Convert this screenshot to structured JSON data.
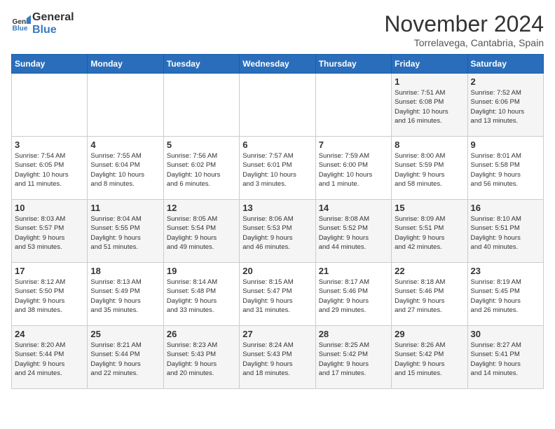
{
  "header": {
    "logo_general": "General",
    "logo_blue": "Blue",
    "month_title": "November 2024",
    "location": "Torrelavega, Cantabria, Spain"
  },
  "weekdays": [
    "Sunday",
    "Monday",
    "Tuesday",
    "Wednesday",
    "Thursday",
    "Friday",
    "Saturday"
  ],
  "weeks": [
    [
      {
        "day": "",
        "info": ""
      },
      {
        "day": "",
        "info": ""
      },
      {
        "day": "",
        "info": ""
      },
      {
        "day": "",
        "info": ""
      },
      {
        "day": "",
        "info": ""
      },
      {
        "day": "1",
        "info": "Sunrise: 7:51 AM\nSunset: 6:08 PM\nDaylight: 10 hours\nand 16 minutes."
      },
      {
        "day": "2",
        "info": "Sunrise: 7:52 AM\nSunset: 6:06 PM\nDaylight: 10 hours\nand 13 minutes."
      }
    ],
    [
      {
        "day": "3",
        "info": "Sunrise: 7:54 AM\nSunset: 6:05 PM\nDaylight: 10 hours\nand 11 minutes."
      },
      {
        "day": "4",
        "info": "Sunrise: 7:55 AM\nSunset: 6:04 PM\nDaylight: 10 hours\nand 8 minutes."
      },
      {
        "day": "5",
        "info": "Sunrise: 7:56 AM\nSunset: 6:02 PM\nDaylight: 10 hours\nand 6 minutes."
      },
      {
        "day": "6",
        "info": "Sunrise: 7:57 AM\nSunset: 6:01 PM\nDaylight: 10 hours\nand 3 minutes."
      },
      {
        "day": "7",
        "info": "Sunrise: 7:59 AM\nSunset: 6:00 PM\nDaylight: 10 hours\nand 1 minute."
      },
      {
        "day": "8",
        "info": "Sunrise: 8:00 AM\nSunset: 5:59 PM\nDaylight: 9 hours\nand 58 minutes."
      },
      {
        "day": "9",
        "info": "Sunrise: 8:01 AM\nSunset: 5:58 PM\nDaylight: 9 hours\nand 56 minutes."
      }
    ],
    [
      {
        "day": "10",
        "info": "Sunrise: 8:03 AM\nSunset: 5:57 PM\nDaylight: 9 hours\nand 53 minutes."
      },
      {
        "day": "11",
        "info": "Sunrise: 8:04 AM\nSunset: 5:55 PM\nDaylight: 9 hours\nand 51 minutes."
      },
      {
        "day": "12",
        "info": "Sunrise: 8:05 AM\nSunset: 5:54 PM\nDaylight: 9 hours\nand 49 minutes."
      },
      {
        "day": "13",
        "info": "Sunrise: 8:06 AM\nSunset: 5:53 PM\nDaylight: 9 hours\nand 46 minutes."
      },
      {
        "day": "14",
        "info": "Sunrise: 8:08 AM\nSunset: 5:52 PM\nDaylight: 9 hours\nand 44 minutes."
      },
      {
        "day": "15",
        "info": "Sunrise: 8:09 AM\nSunset: 5:51 PM\nDaylight: 9 hours\nand 42 minutes."
      },
      {
        "day": "16",
        "info": "Sunrise: 8:10 AM\nSunset: 5:51 PM\nDaylight: 9 hours\nand 40 minutes."
      }
    ],
    [
      {
        "day": "17",
        "info": "Sunrise: 8:12 AM\nSunset: 5:50 PM\nDaylight: 9 hours\nand 38 minutes."
      },
      {
        "day": "18",
        "info": "Sunrise: 8:13 AM\nSunset: 5:49 PM\nDaylight: 9 hours\nand 35 minutes."
      },
      {
        "day": "19",
        "info": "Sunrise: 8:14 AM\nSunset: 5:48 PM\nDaylight: 9 hours\nand 33 minutes."
      },
      {
        "day": "20",
        "info": "Sunrise: 8:15 AM\nSunset: 5:47 PM\nDaylight: 9 hours\nand 31 minutes."
      },
      {
        "day": "21",
        "info": "Sunrise: 8:17 AM\nSunset: 5:46 PM\nDaylight: 9 hours\nand 29 minutes."
      },
      {
        "day": "22",
        "info": "Sunrise: 8:18 AM\nSunset: 5:46 PM\nDaylight: 9 hours\nand 27 minutes."
      },
      {
        "day": "23",
        "info": "Sunrise: 8:19 AM\nSunset: 5:45 PM\nDaylight: 9 hours\nand 26 minutes."
      }
    ],
    [
      {
        "day": "24",
        "info": "Sunrise: 8:20 AM\nSunset: 5:44 PM\nDaylight: 9 hours\nand 24 minutes."
      },
      {
        "day": "25",
        "info": "Sunrise: 8:21 AM\nSunset: 5:44 PM\nDaylight: 9 hours\nand 22 minutes."
      },
      {
        "day": "26",
        "info": "Sunrise: 8:23 AM\nSunset: 5:43 PM\nDaylight: 9 hours\nand 20 minutes."
      },
      {
        "day": "27",
        "info": "Sunrise: 8:24 AM\nSunset: 5:43 PM\nDaylight: 9 hours\nand 18 minutes."
      },
      {
        "day": "28",
        "info": "Sunrise: 8:25 AM\nSunset: 5:42 PM\nDaylight: 9 hours\nand 17 minutes."
      },
      {
        "day": "29",
        "info": "Sunrise: 8:26 AM\nSunset: 5:42 PM\nDaylight: 9 hours\nand 15 minutes."
      },
      {
        "day": "30",
        "info": "Sunrise: 8:27 AM\nSunset: 5:41 PM\nDaylight: 9 hours\nand 14 minutes."
      }
    ]
  ]
}
